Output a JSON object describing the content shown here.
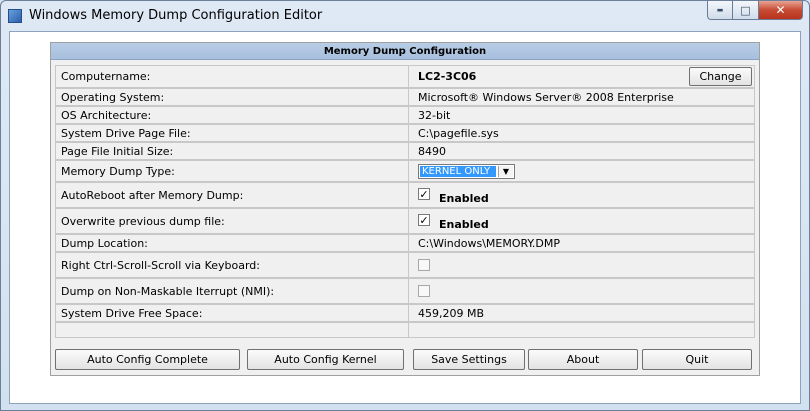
{
  "window": {
    "title": "Windows Memory Dump Configuration Editor",
    "minimize_glyph": "▬",
    "maximize_glyph": "□",
    "close_glyph": "✕"
  },
  "panel": {
    "header": "Memory Dump Configuration"
  },
  "rows": {
    "computername": {
      "label": "Computername:",
      "value": "LC2-3C06",
      "button": "Change"
    },
    "os": {
      "label": "Operating System:",
      "value": "Microsoft® Windows Server® 2008 Enterprise"
    },
    "arch": {
      "label": "OS Architecture:",
      "value": "32-bit"
    },
    "pagefile": {
      "label": "System Drive Page File:",
      "value": "C:\\pagefile.sys"
    },
    "pagefile_size": {
      "label": "Page File Initial Size:",
      "value": "8490"
    },
    "dump_type": {
      "label": "Memory Dump Type:",
      "selected": "KERNEL ONLY"
    },
    "autoreboot": {
      "label": "AutoReboot after Memory Dump:",
      "checked": true,
      "check_label": "Enabled"
    },
    "overwrite": {
      "label": "Overwrite previous dump file:",
      "checked": true,
      "check_label": "Enabled"
    },
    "dump_location": {
      "label": "Dump Location:",
      "value": "C:\\Windows\\MEMORY.DMP"
    },
    "ctrl_scroll": {
      "label": "Right Ctrl-Scroll-Scroll via Keyboard:",
      "checked": false
    },
    "nmi": {
      "label": "Dump on Non-Maskable Iterrupt (NMI):",
      "checked": false
    },
    "free_space": {
      "label": "System Drive Free Space:",
      "value": "459,209 MB"
    }
  },
  "buttons": {
    "auto_config_complete": "Auto Config Complete",
    "auto_config_kernel": "Auto Config Kernel",
    "save_settings": "Save Settings",
    "about": "About",
    "quit": "Quit"
  },
  "colors": {
    "header_bg": "#b8cde6",
    "selection": "#3399ff",
    "close_button": "#c74b34"
  },
  "icons": {
    "app": "application-icon",
    "check": "checkmark-icon",
    "dropdown": "chevron-down-icon"
  }
}
